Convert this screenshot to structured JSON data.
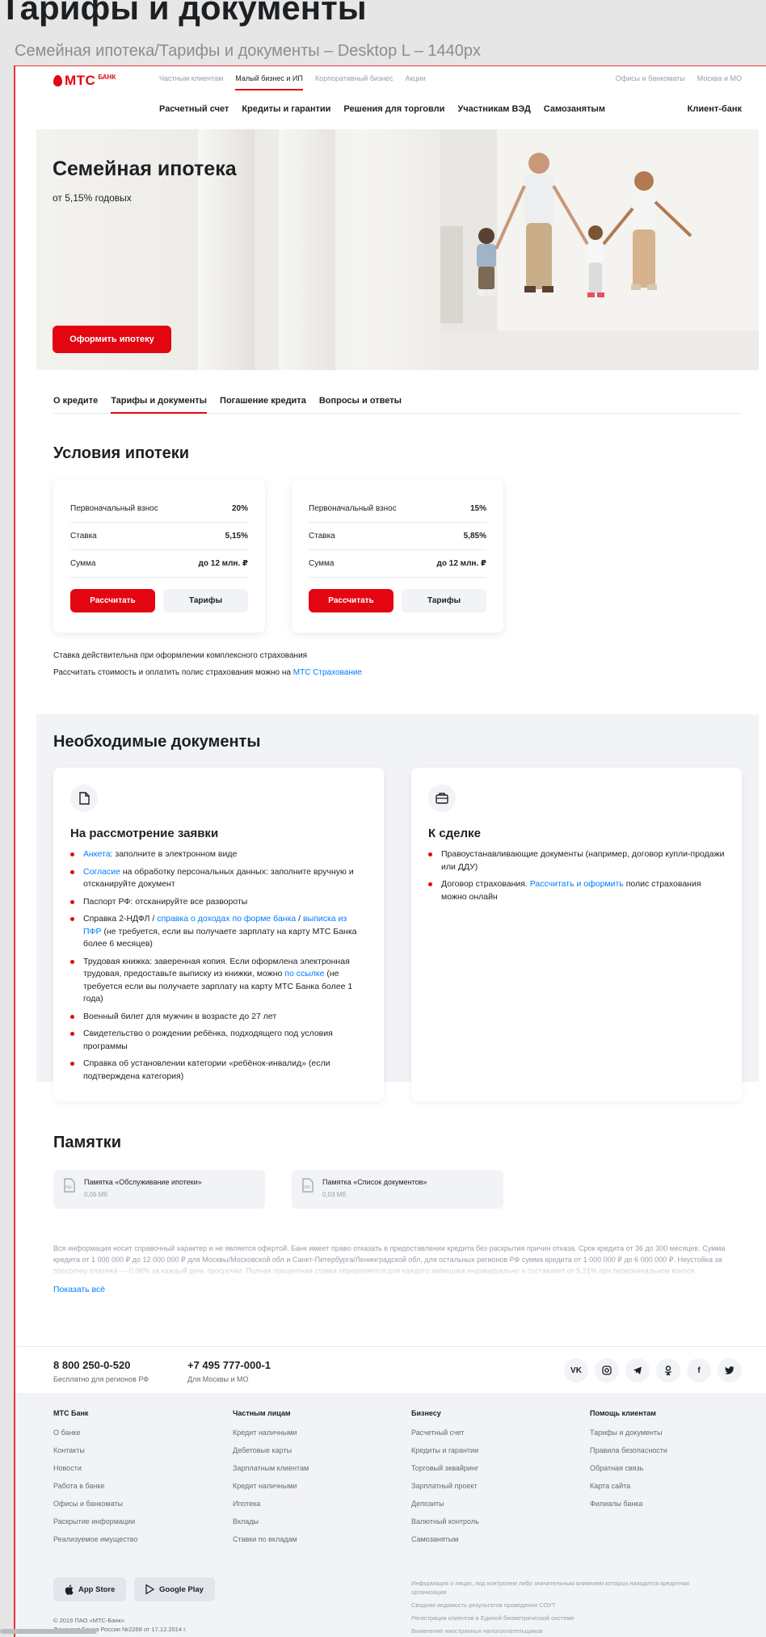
{
  "canvas": {
    "title": "Тарифы и документы",
    "subtitle": "Семейная ипотека/Тарифы и документы – Desktop L – 1440px"
  },
  "header": {
    "logo_text": "МТС",
    "logo_bank": "БАНК",
    "top_nav": [
      "Частным клиентам",
      "Малый бизнес и ИП",
      "Корпоративный бизнес",
      "Акции"
    ],
    "top_nav_active_index": 1,
    "top_right": [
      "Офисы и банкоматы",
      "Москва и МО"
    ],
    "main_nav": [
      "Расчетный счет",
      "Кредиты и гарантии",
      "Решения для торговли",
      "Участникам ВЭД",
      "Самозанятым"
    ],
    "client_bank": "Клиент-банк"
  },
  "hero": {
    "title": "Семейная ипотека",
    "subtitle": "от 5,15% годовых",
    "button": "Оформить ипотеку"
  },
  "tabs": [
    "О кредите",
    "Тарифы и документы",
    "Погашение кредита",
    "Вопросы и ответы"
  ],
  "tabs_active_index": 1,
  "conditions": {
    "title": "Условия ипотеки",
    "cards": [
      {
        "rows": [
          {
            "label": "Первоначальный взнос",
            "value": "20%"
          },
          {
            "label": "Ставка",
            "value": "5,15%"
          },
          {
            "label": "Сумма",
            "value": "до 12 млн. ₽"
          }
        ],
        "calc": "Рассчитать",
        "tariffs": "Тарифы"
      },
      {
        "rows": [
          {
            "label": "Первоначальный взнос",
            "value": "15%"
          },
          {
            "label": "Ставка",
            "value": "5,85%"
          },
          {
            "label": "Сумма",
            "value": "до 12 млн. ₽"
          }
        ],
        "calc": "Рассчитать",
        "tariffs": "Тарифы"
      }
    ],
    "note1": "Ставка действительна при оформлении комплексного страхования",
    "note2_text": "Рассчитать стоимость и оплатить полис страхования можно на ",
    "note2_link": "МТС Страхование"
  },
  "documents": {
    "title": "Необходимые документы",
    "application": {
      "title": "На рассмотрение заявки",
      "items": [
        {
          "link": "Анкета",
          "text": ": заполните в электронном виде"
        },
        {
          "link": "Согласие",
          "text": " на обработку персональных данных: заполните вручную и отсканируйте документ"
        },
        {
          "text": "Паспорт РФ: отсканируйте все развороты"
        },
        {
          "pre": "Справка 2-НДФЛ / ",
          "link": "справка о доходах по форме банка",
          "mid": " / ",
          "link2": "выписка из ПФР",
          "text": " (не требуется, если вы получаете зарплату на карту МТС Банка более 6 месяцев)"
        },
        {
          "pre": "Трудовая книжка: заверенная копия. Если оформлена электронная трудовая, предоставьте выписку из книжки, можно ",
          "link": "по ссылке",
          "text": " (не требуется если вы получаете зарплату на карту МТС Банка более 1 года)"
        },
        {
          "text": "Военный билет для мужчин в возрасте до 27 лет"
        },
        {
          "text": "Свидетельство о рождении ребёнка, подходящего под условия программы"
        },
        {
          "text": "Справка об установлении категории «ребёнок-инвалид» (если подтверждена категория)"
        }
      ]
    },
    "deal": {
      "title": "К сделке",
      "items": [
        {
          "text": "Правоустанавливающие документы (например, договор купли-продажи или ДДУ)"
        },
        {
          "pre": "Договор страхования. ",
          "link": "Рассчитать и оформить",
          "text": " полис страхования можно онлайн"
        }
      ]
    }
  },
  "memos": {
    "title": "Памятки",
    "items": [
      {
        "name": "Памятка «Обслуживание ипотеки»",
        "size": "0,06 Мб"
      },
      {
        "name": "Памятка «Список документов»",
        "size": "0,03 Мб"
      }
    ]
  },
  "disclaimer": {
    "text": "Вся информация носит справочный характер и не является офертой. Банк имеет право отказать в предоставлении кредита без раскрытия причин отказа. Срок кредита от 36 до 300 месяцев. Сумма кредита от 1 000 000 ₽ до 12 000 000 ₽ для Москвы/Московской обл и Санкт-Петербурга/Ленинградской обл, для остальных регионов РФ сумма кредита от 1 000 000 ₽ до 6 000 000 ₽. Неустойка за просрочку платежа — 0,06% за каждый день просрочки. Полная процентная ставка определяется для каждого заёмщика индивидуально и составляет от 5,21% при первоначальном взносе.",
    "show_all": "Показать всё"
  },
  "contacts": [
    {
      "number": "8 800 250-0-520",
      "desc": "Бесплатно для регионов РФ"
    },
    {
      "number": "+7 495 777-000-1",
      "desc": "Для Москвы и МО"
    }
  ],
  "socials": [
    "vk-icon",
    "instagram-icon",
    "telegram-icon",
    "odnoklassniki-icon",
    "facebook-icon",
    "twitter-icon"
  ],
  "footer": {
    "columns": [
      {
        "title": "МТС Банк",
        "items": [
          "О банке",
          "Контакты",
          "Новости",
          "Работа в банке",
          "Офисы и банкоматы",
          "Раскрытие информации",
          "Реализуемое имущество"
        ]
      },
      {
        "title": "Частным лицам",
        "items": [
          "Кредит наличными",
          "Дебетовые карты",
          "Зарплатным клиентам",
          "Кредит наличными",
          "Ипотека",
          "Вклады",
          "Ставки по вкладам"
        ]
      },
      {
        "title": "Бизнесу",
        "items": [
          "Расчетный счет",
          "Кредиты и гарантии",
          "Торговый эквайринг",
          "Зарплатный проект",
          "Депозиты",
          "Валютный контроль",
          "Самозанятым"
        ]
      },
      {
        "title": "Помощь клиентам",
        "items": [
          "Тарифы и документы",
          "Правила безопасности",
          "Обратная связь",
          "Карта сайта",
          "Филиалы банка"
        ]
      }
    ],
    "app_store": "App Store",
    "google_play": "Google Play",
    "copyright1": "© 2019 ПАО «МТС-Банк»",
    "copyright2": "Лицензия Банка России №2268 от 17.12.2014 г.",
    "legal": [
      "Информация о лицах, под контролем либо значительным влиянием которых находится кредитная организация",
      "Сводная ведомость результатов проведения СОУТ",
      "Регистрация клиентов в Единой биометрической системе",
      "Выявление иностранных налогоплательщиков"
    ]
  },
  "colors": {
    "brand": "#e30611",
    "link": "#007cff",
    "frame": "#e8343a"
  }
}
